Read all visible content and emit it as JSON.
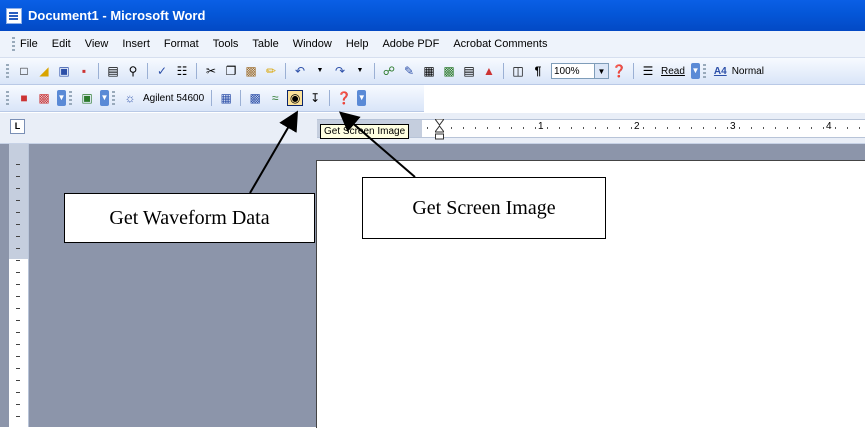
{
  "window": {
    "title": "Document1 - Microsoft Word"
  },
  "menu": [
    "File",
    "Edit",
    "View",
    "Insert",
    "Format",
    "Tools",
    "Table",
    "Window",
    "Help",
    "Adobe PDF",
    "Acrobat Comments"
  ],
  "toolbar1": {
    "zoom": "100%",
    "read_label": "Read",
    "style": "Normal",
    "style_icon": "A4"
  },
  "toolbar2": {
    "device_label": "Agilent 54600"
  },
  "tooltip": "Get Screen Image",
  "ruler": {
    "marks": [
      "1",
      "2",
      "3",
      "4"
    ]
  },
  "callouts": {
    "waveform": "Get Waveform Data",
    "screen": "Get Screen Image"
  }
}
